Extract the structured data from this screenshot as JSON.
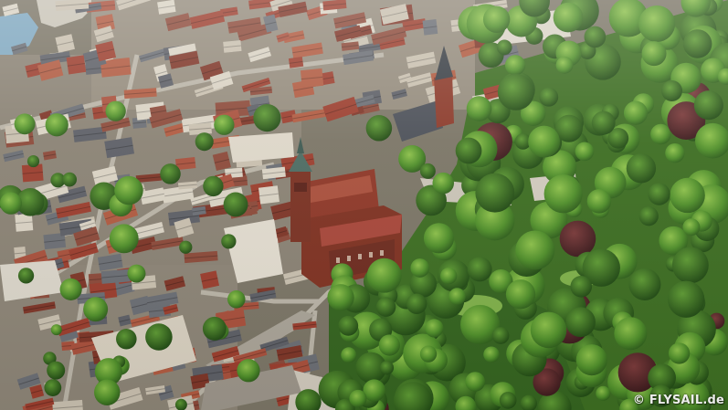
{
  "image": {
    "subject": "aerial-view-town-with-red-brick-building-and-park",
    "watermark": "© FLYSAIL.de"
  },
  "palette": {
    "roof_red": "#9b3e2e",
    "roof_grey": "#5d5f66",
    "facade_light": "#d9d2c3",
    "tree_green": "#3f7a26",
    "tree_light": "#7db23a",
    "water": "#7fa7bf",
    "street": "#b9b3a6"
  }
}
